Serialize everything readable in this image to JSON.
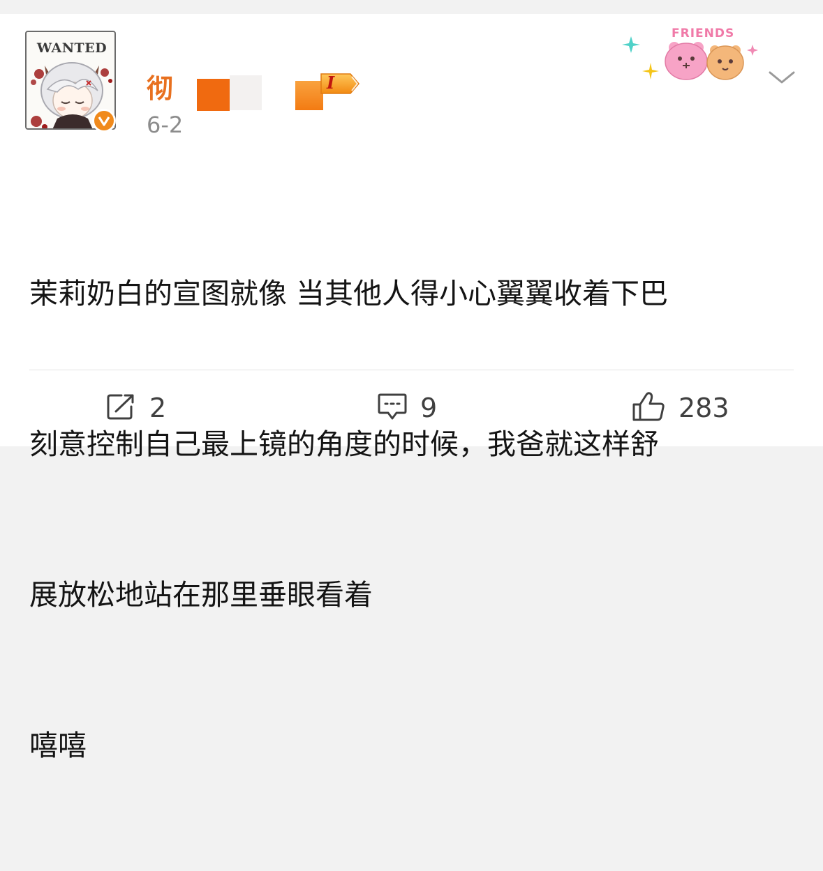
{
  "header": {
    "avatar_label": "WANTED",
    "user_name_visible": "彻",
    "badge_text": "I",
    "time": "6-2",
    "decor_text": "FRIENDS"
  },
  "post": {
    "lines": [
      "茉莉奶白的宣图就像 当其他人得小心翼翼收着下巴",
      "刻意控制自己最上镜的角度的时候，我爸就这样舒",
      "展放松地站在那里垂眼看着",
      "嘻嘻"
    ]
  },
  "actions": {
    "share_count": "2",
    "comment_count": "9",
    "like_count": "283"
  },
  "colors": {
    "name": "#e8701f",
    "verified": "#f08a1c",
    "divider": "#e3e3e3"
  },
  "icons": [
    "verified-icon",
    "chevron-down-icon",
    "share-icon",
    "comment-icon",
    "like-icon"
  ]
}
